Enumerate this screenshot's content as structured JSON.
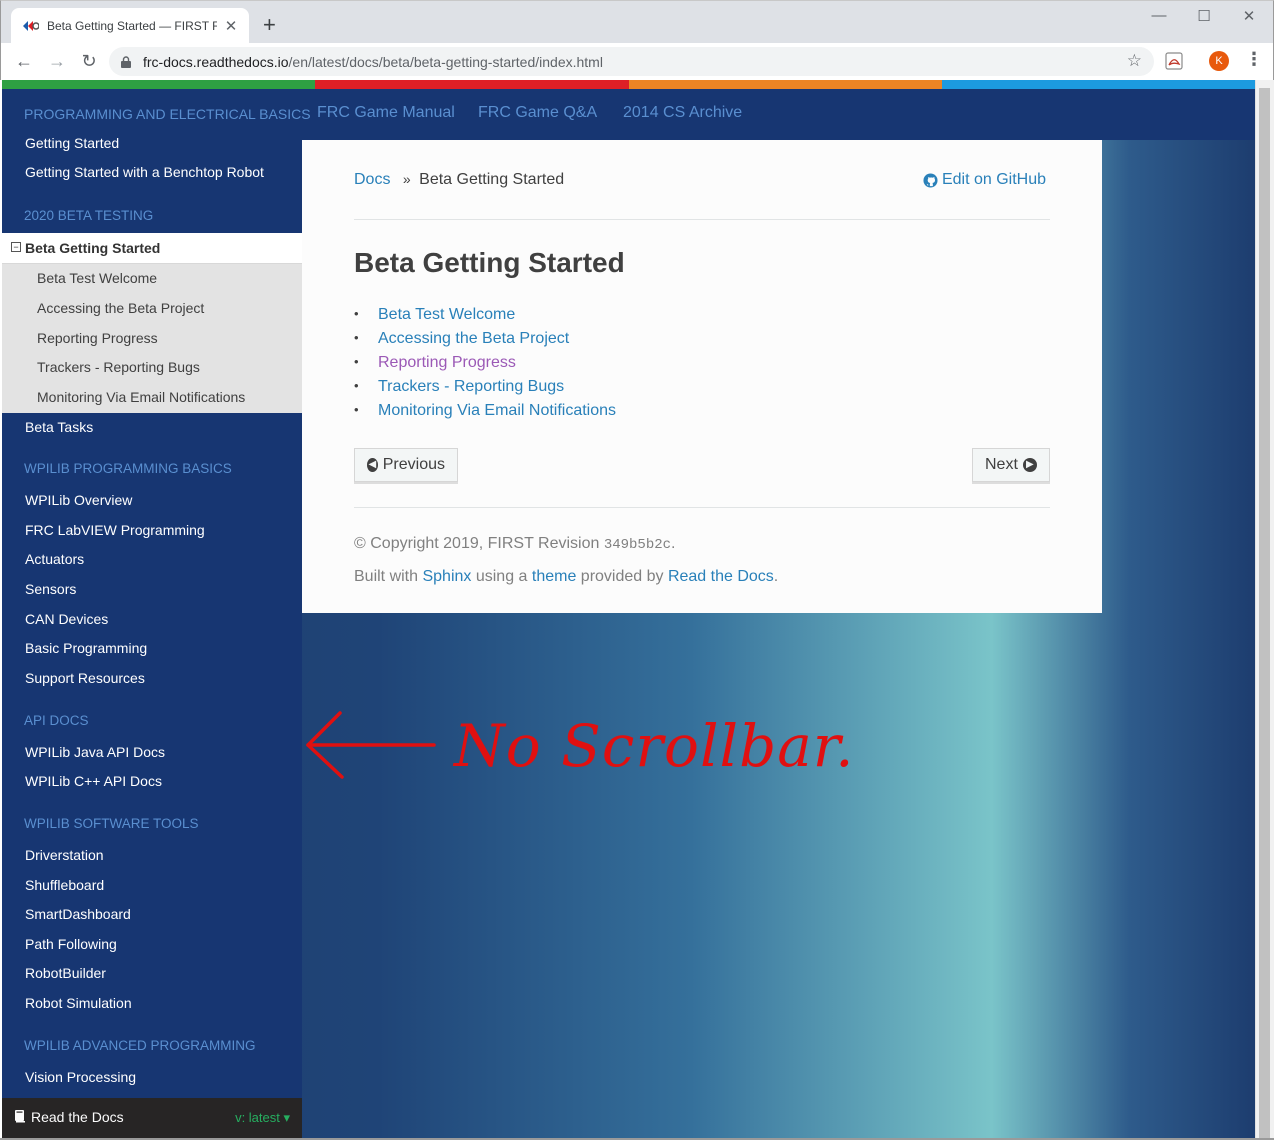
{
  "browser": {
    "tab_title": "Beta Getting Started — FIRST Ro",
    "tab_close": "✕",
    "new_tab": "+",
    "minimize": "—",
    "maximize": "☐",
    "close": "✕",
    "back": "←",
    "forward": "→",
    "reload": "↻",
    "url_host": "frc-docs.readthedocs.io",
    "url_path": "/en/latest/docs/beta/beta-getting-started/index.html",
    "star": "☆",
    "profile_initial": "K",
    "menu": "⋮"
  },
  "colors": {
    "stripe": [
      "#2ea043",
      "#de1f26",
      "#ec8424",
      "#1c9ae0"
    ],
    "sidebar_bg": "#173672",
    "caption": "#5a8fd0",
    "link": "#2980b9",
    "visited_link": "#9b59b6",
    "annotation": "#e01010"
  },
  "topnav": {
    "section": "PROGRAMMING AND ELECTRICAL BASICS",
    "links": [
      "FRC Game Manual",
      "FRC Game Q&A",
      "2014 CS Archive"
    ]
  },
  "sidebar": {
    "getting_started": [
      "Getting Started",
      "Getting Started with a Benchtop Robot"
    ],
    "beta_caption": "2020 BETA TESTING",
    "current_toggle": "−",
    "current": "Beta Getting Started",
    "current_children": [
      "Beta Test Welcome",
      "Accessing the Beta Project",
      "Reporting Progress",
      "Trackers - Reporting Bugs",
      "Monitoring Via Email Notifications"
    ],
    "beta_tasks": "Beta Tasks",
    "wpilib_basics_caption": "WPILIB PROGRAMMING BASICS",
    "wpilib_basics": [
      "WPILib Overview",
      "FRC LabVIEW Programming",
      "Actuators",
      "Sensors",
      "CAN Devices",
      "Basic Programming",
      "Support Resources"
    ],
    "api_caption": "API DOCS",
    "api": [
      "WPILib Java API Docs",
      "WPILib C++ API Docs"
    ],
    "tools_caption": "WPILIB SOFTWARE TOOLS",
    "tools": [
      "Driverstation",
      "Shuffleboard",
      "SmartDashboard",
      "Path Following",
      "RobotBuilder",
      "Robot Simulation"
    ],
    "advanced_caption": "WPILIB ADVANCED PROGRAMMING",
    "advanced": [
      "Vision Processing"
    ]
  },
  "rtd": {
    "label": "Read the Docs",
    "version": "v: latest ▾"
  },
  "content": {
    "breadcrumb_docs": "Docs",
    "breadcrumb_sep": "»",
    "breadcrumb_current": "Beta Getting Started",
    "edit_github": "Edit on GitHub",
    "title": "Beta Getting Started",
    "toc": [
      "Beta Test Welcome",
      "Accessing the Beta Project",
      "Reporting Progress",
      "Trackers - Reporting Bugs",
      "Monitoring Via Email Notifications"
    ],
    "previous": "Previous",
    "next": "Next",
    "copyright": "© Copyright 2019, FIRST Revision ",
    "revision": "349b5b2c",
    "period": ".",
    "built_with": "Built with ",
    "sphinx": "Sphinx",
    "using_a": " using a ",
    "theme": "theme",
    "provided_by": " provided by ",
    "read_the_docs": "Read the Docs",
    "built_period": "."
  },
  "annotation": {
    "text": "No Scrollbar."
  }
}
